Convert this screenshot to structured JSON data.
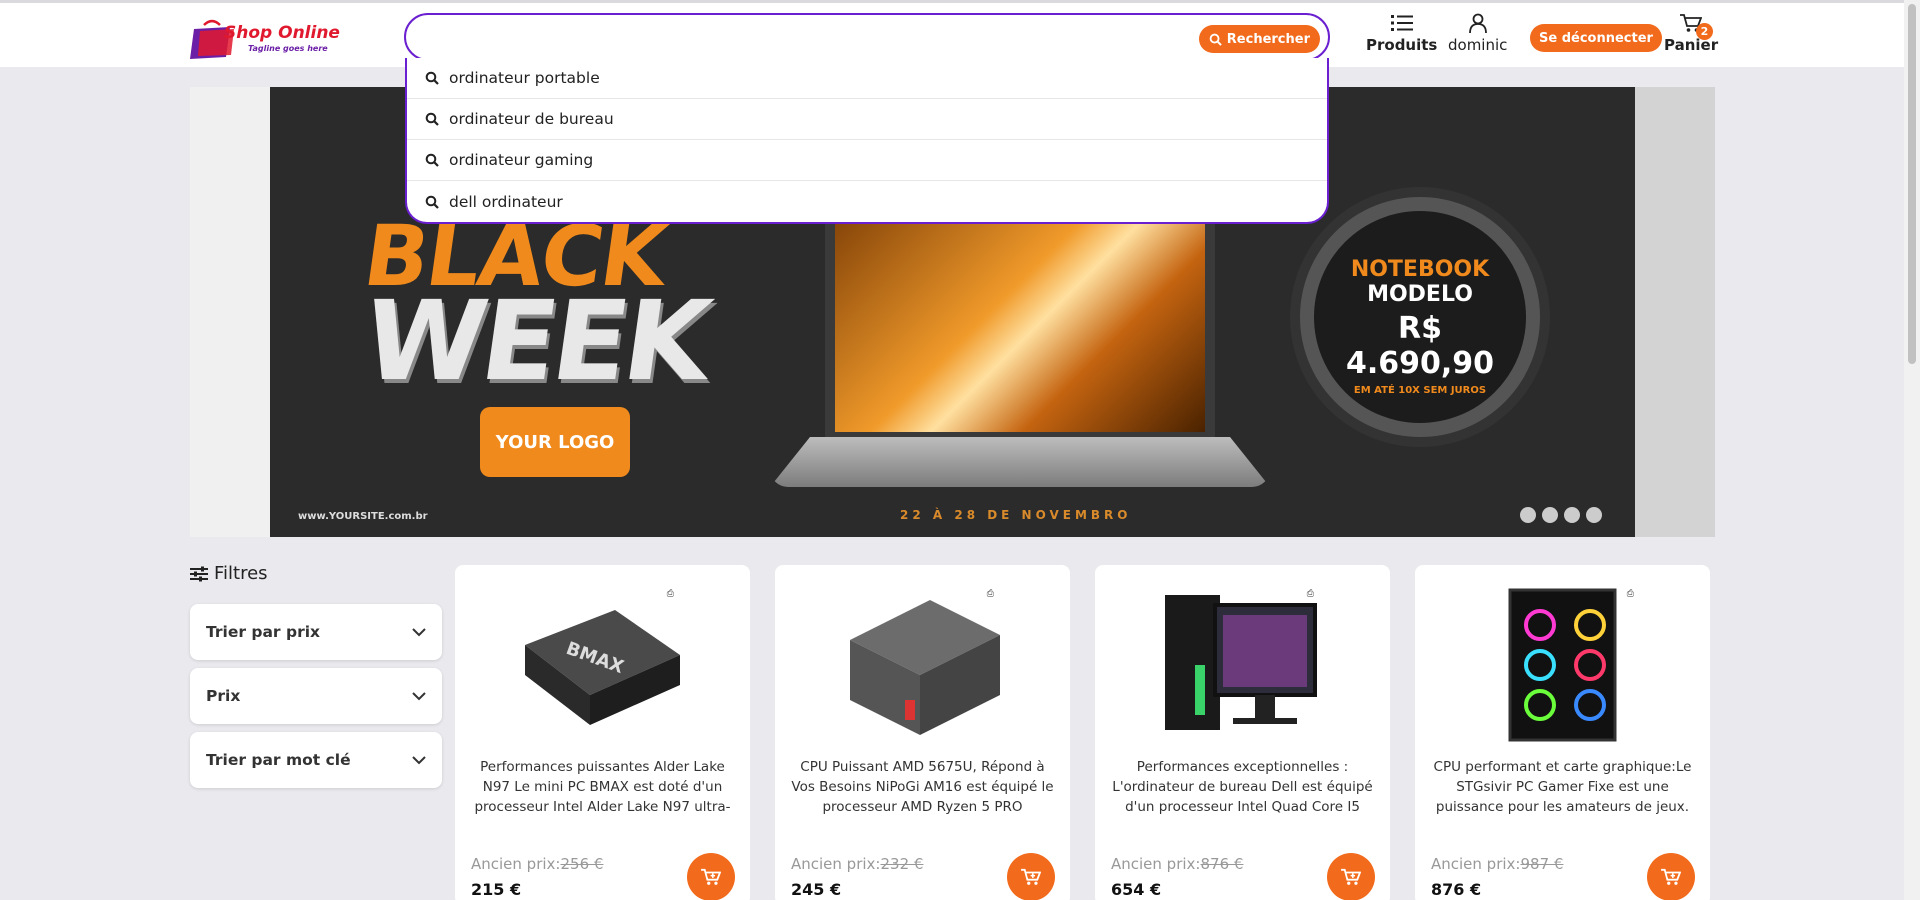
{
  "header": {
    "logo_text": "Shop Online",
    "logo_tagline": "Tagline goes here",
    "search": {
      "value": "",
      "placeholder": "",
      "button_label": "Rechercher"
    },
    "suggestions": [
      "ordinateur portable",
      "ordinateur de bureau",
      "ordinateur gaming",
      "dell ordinateur"
    ],
    "nav_products": "Produits",
    "nav_user": "dominic",
    "logout_label": "Se déconnecter",
    "cart_label": "Panier",
    "cart_count": "2"
  },
  "banner": {
    "line1": "BLACK",
    "line2": "WEEK",
    "logo_label": "YOUR LOGO",
    "site": "www.YOURSITE.com.br",
    "dates": "22 À 28 DE NOVEMBRO",
    "ring_line1": "NOTEBOOK",
    "ring_line2": "MODELO",
    "ring_price": "R$ 4.690,90",
    "ring_terms": "EM ATÉ 10X SEM JUROS"
  },
  "filters": {
    "title": "Filtres",
    "items": [
      "Trier par prix",
      "Prix",
      "Trier par mot clé"
    ]
  },
  "products": [
    {
      "desc": "Performances puissantes Alder Lake N97 Le mini PC BMAX est doté d'un processeur Intel Alder Lake N97 ultra-",
      "old_label": "Ancien prix:",
      "old_price": "256 €",
      "price": "215 €",
      "image": "mini-pc-bmax"
    },
    {
      "desc": "CPU Puissant AMD 5675U, Répond à Vos Besoins NiPoGi AM16 est équipé le processeur AMD Ryzen 5 PRO",
      "old_label": "Ancien prix:",
      "old_price": "232 €",
      "price": "245 €",
      "image": "mini-pc-nipogi"
    },
    {
      "desc": "Performances exceptionnelles : L'ordinateur de bureau Dell est équipé d'un processeur Intel Quad Core I5",
      "old_label": "Ancien prix:",
      "old_price": "876 €",
      "price": "654 €",
      "image": "desktop-dell"
    },
    {
      "desc": "CPU performant et carte graphique:Le STGsivir PC Gamer Fixe est une puissance pour les amateurs de jeux. Équipé d'une",
      "old_label": "Ancien prix:",
      "old_price": "987 €",
      "price": "876 €",
      "image": "gaming-pc"
    }
  ],
  "colors": {
    "accent": "#f26a1b",
    "search_border": "#6a1fd0",
    "background": "#e9e9ee"
  }
}
